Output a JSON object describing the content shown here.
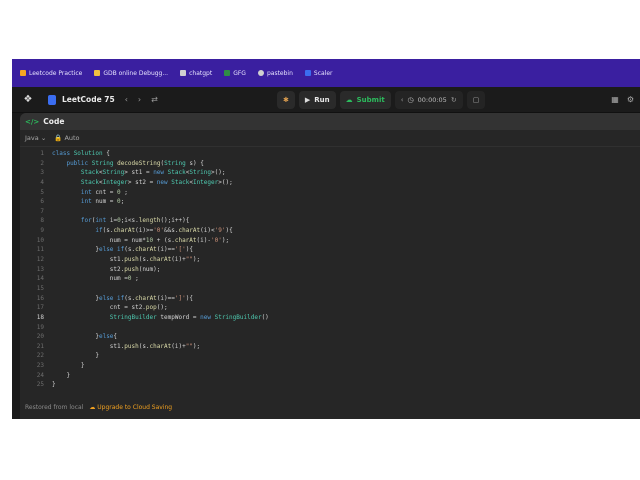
{
  "bookmarks": [
    {
      "label": "Leetcode Practice",
      "icon": "list-icon",
      "color": "#f5a623"
    },
    {
      "label": "GDB online Debugg...",
      "icon": "gdb-icon",
      "color": "#f0c040"
    },
    {
      "label": "chatgpt",
      "icon": "chatgpt-icon",
      "color": "#d0d0d0"
    },
    {
      "label": "GFG",
      "icon": "gfg-icon",
      "color": "#2f8d46"
    },
    {
      "label": "pastebin",
      "icon": "pastebin-icon",
      "color": "#d0d0d0"
    },
    {
      "label": "Scaler",
      "icon": "scaler-icon",
      "color": "#3b6df0"
    }
  ],
  "nav": {
    "title": "LeetCode 75",
    "run_label": "Run",
    "submit_label": "Submit",
    "timer": "00:00:05"
  },
  "panel": {
    "title": "Code",
    "language": "Java",
    "mode": "Auto"
  },
  "code": {
    "active_line": 18,
    "lines": [
      "class Solution {",
      "    public String decodeString(String s) {",
      "        Stack<String> st1 = new Stack<String>();",
      "        Stack<Integer> st2 = new Stack<Integer>();",
      "        int cnt = 0 ;",
      "        int num = 0;",
      "",
      "        for(int i=0;i<s.length();i++){",
      "            if(s.charAt(i)>='0'&&s.charAt(i)<'9'){",
      "                num = num*10 + (s.charAt(i)-'0');",
      "            }else if(s.charAt(i)=='['){",
      "                st1.push(s.charAt(i)+\"\");",
      "                st2.push(num);",
      "                num =0 ;",
      "",
      "            }else if(s.charAt(i)==']'){",
      "                cnt = st2.pop();",
      "                StringBuilder tempWord = new StringBuilder()",
      "",
      "            }else{",
      "                st1.push(s.charAt(i)+\"\");",
      "            }",
      "        }",
      "    }",
      "}"
    ]
  },
  "status": {
    "restored": "Restored from local",
    "upgrade": "Upgrade to Cloud Saving"
  },
  "colors": {
    "bookmarks_bg": "#3a1fa0",
    "accent_green": "#2cbb5d",
    "editor_bg": "#262626"
  }
}
